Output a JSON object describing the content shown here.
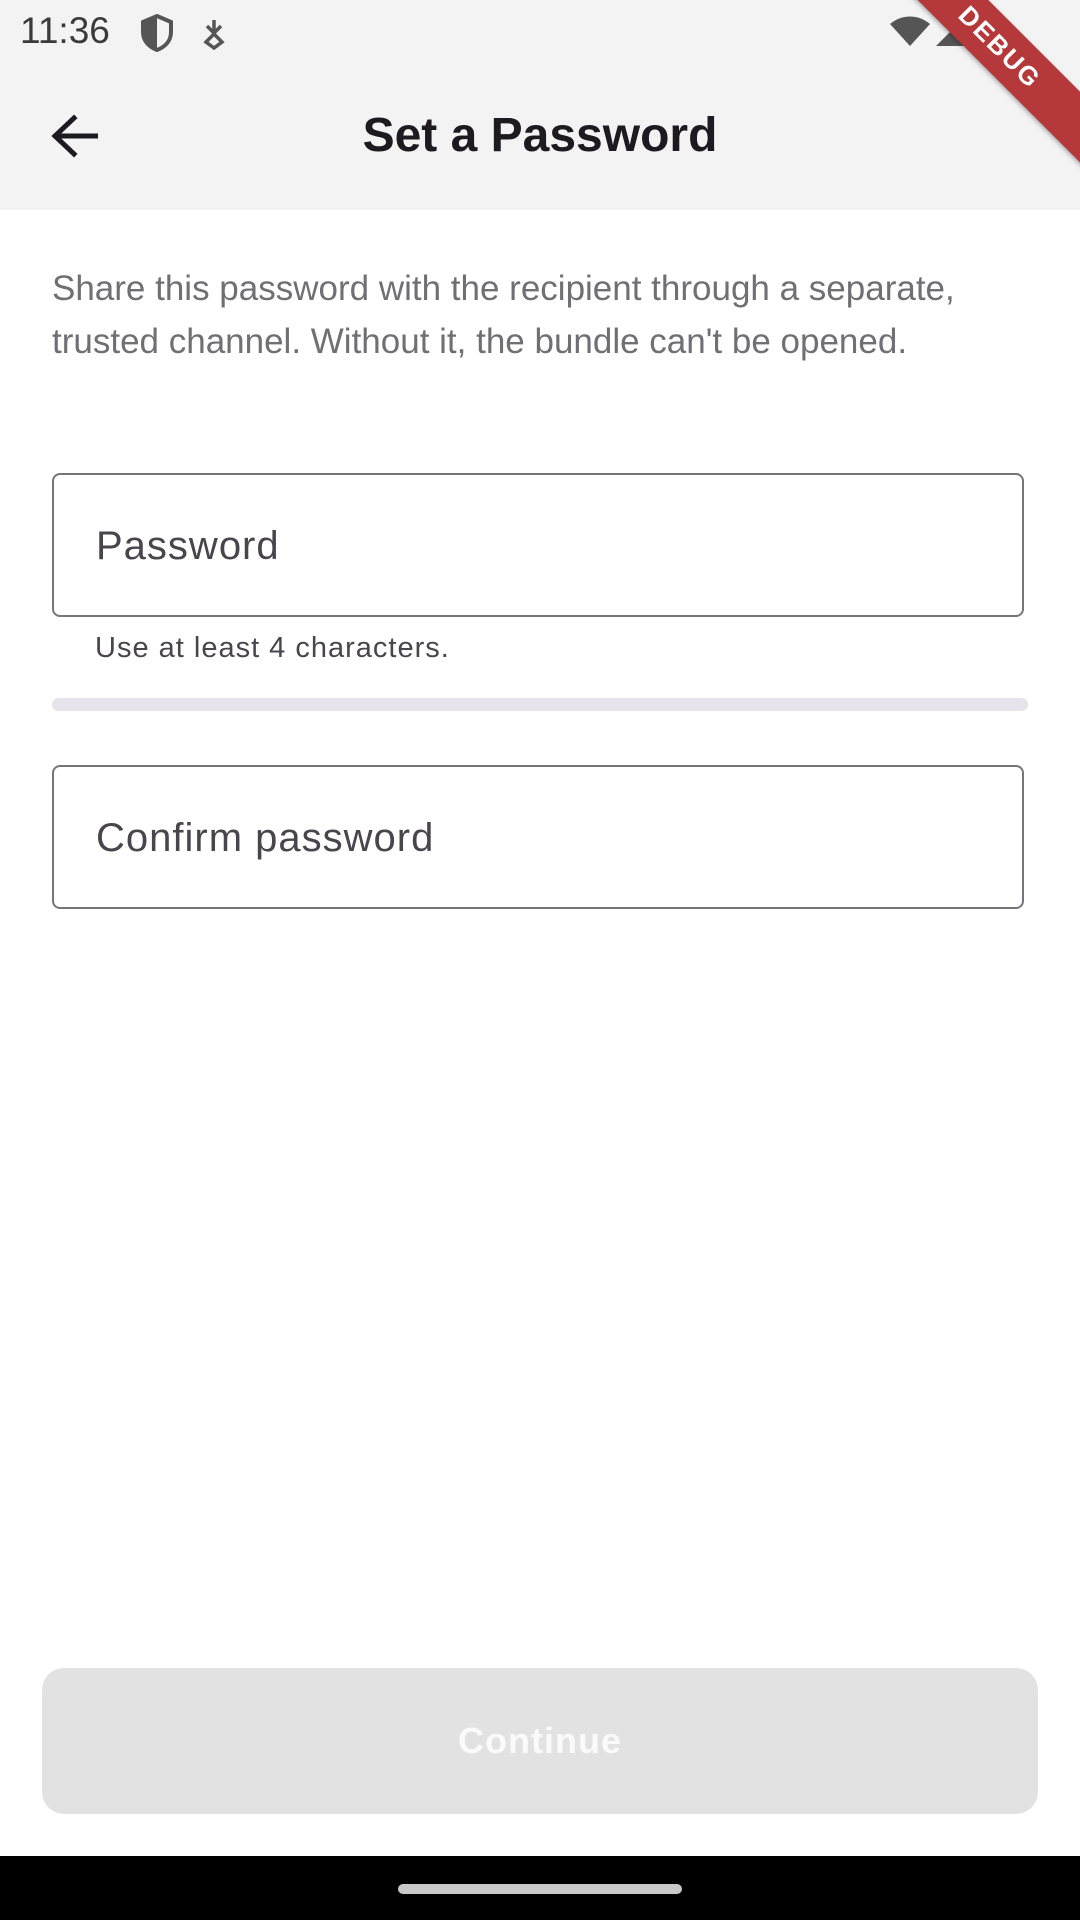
{
  "status_bar": {
    "time": "11:36",
    "left_icons": [
      "shield-icon",
      "download-icon"
    ],
    "right_icons": [
      "wifi-icon",
      "signal-icon",
      "battery-icon"
    ]
  },
  "app_bar": {
    "title": "Set a Password",
    "back_icon": "arrow-left-icon"
  },
  "debug_banner": "DEBUG",
  "description": "Share this password with the recipient through a separate, trusted channel. Without it, the bundle can't be opened.",
  "password_field": {
    "placeholder": "Password",
    "value": "",
    "helper": "Use at least 4 characters."
  },
  "strength_meter": {
    "level": 0,
    "track_color": "#e6e4ea"
  },
  "confirm_field": {
    "placeholder": "Confirm password",
    "value": ""
  },
  "continue_button": {
    "label": "Continue",
    "enabled": false
  },
  "colors": {
    "app_bar_bg": "#f3f3f4",
    "title": "#1d1b20",
    "description": "#6f6f74",
    "disabled_button_bg": "#e2e2e3",
    "debug_banner": "#b5393a"
  }
}
